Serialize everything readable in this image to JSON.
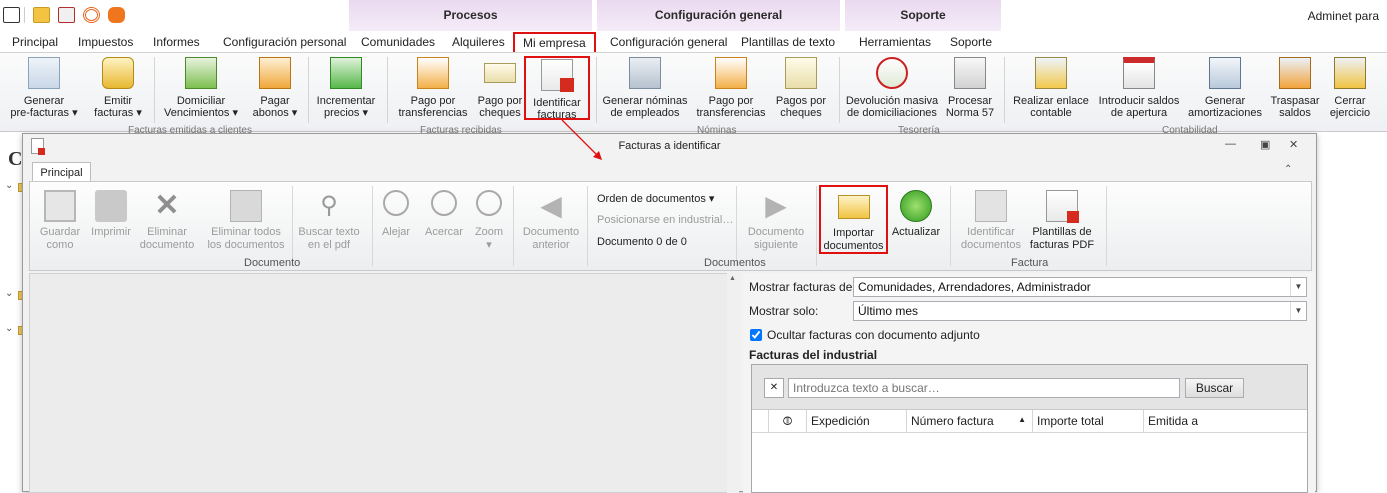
{
  "top": {
    "quick_access": [
      "app-icon",
      "mail-icon",
      "clipboard-icon",
      "rss-icon",
      "owl-icon"
    ],
    "context_groups": [
      "Procesos",
      "Configuración general",
      "Soporte"
    ],
    "app_title": "Adminet para"
  },
  "tabs": [
    "Principal",
    "Impuestos",
    "Informes",
    "Configuración personal",
    "Comunidades",
    "Alquileres",
    "Mi empresa",
    "Configuración general",
    "Plantillas de texto",
    "Herramientas",
    "Soporte"
  ],
  "ribbon": {
    "buttons": [
      {
        "l1": "Generar",
        "l2": "pre-facturas ▾"
      },
      {
        "l1": "Emitir",
        "l2": "facturas ▾"
      },
      {
        "l1": "Domiciliar",
        "l2": "Vencimientos ▾"
      },
      {
        "l1": "Pagar",
        "l2": "abonos ▾"
      },
      {
        "l1": "Incrementar",
        "l2": "precios ▾"
      },
      {
        "l1": "Pago por",
        "l2": "transferencias"
      },
      {
        "l1": "Pago por",
        "l2": "cheques"
      },
      {
        "l1": "Identificar",
        "l2": "facturas"
      },
      {
        "l1": "Generar nóminas",
        "l2": "de empleados"
      },
      {
        "l1": "Pago por",
        "l2": "transferencias"
      },
      {
        "l1": "Pagos por",
        "l2": "cheques"
      },
      {
        "l1": "Devolución masiva",
        "l2": "de domiciliaciones"
      },
      {
        "l1": "Procesar",
        "l2": "Norma 57"
      },
      {
        "l1": "Realizar enlace",
        "l2": "contable"
      },
      {
        "l1": "Introducir saldos",
        "l2": "de apertura"
      },
      {
        "l1": "Generar",
        "l2": "amortizaciones"
      },
      {
        "l1": "Traspasar",
        "l2": "saldos"
      },
      {
        "l1": "Cerrar",
        "l2": "ejercicio"
      }
    ],
    "group_labels": [
      "Facturas emitidas a clientes",
      "Facturas recibidas",
      "Nóminas",
      "Tesorería",
      "Contabilidad"
    ]
  },
  "dialog": {
    "title": "Facturas a identificar",
    "tab": "Principal",
    "buttons": [
      {
        "l1": "Guardar",
        "l2": "como"
      },
      {
        "l1": "Imprimir",
        "l2": ""
      },
      {
        "l1": "Eliminar",
        "l2": "documento"
      },
      {
        "l1": "Eliminar todos",
        "l2": "los documentos"
      },
      {
        "l1": "Buscar texto",
        "l2": "en el pdf"
      },
      {
        "l1": "Alejar",
        "l2": ""
      },
      {
        "l1": "Acercar",
        "l2": ""
      },
      {
        "l1": "Zoom",
        "l2": "▾"
      },
      {
        "l1": "Documento",
        "l2": "anterior"
      },
      {
        "l1": "Documento",
        "l2": "siguiente"
      },
      {
        "l1": "Importar",
        "l2": "documentos"
      },
      {
        "l1": "Actualizar",
        "l2": ""
      },
      {
        "l1": "Identificar",
        "l2": "documentos"
      },
      {
        "l1": "Plantillas de",
        "l2": "facturas PDF"
      }
    ],
    "order_label": "Orden de documentos ▾",
    "position_label": "Posicionarse en industrial…",
    "doc_counter": "Documento 0 de 0",
    "group_labels": [
      "Documento",
      "Documentos",
      "Factura"
    ],
    "show_invoices_label": "Mostrar facturas de:",
    "show_invoices_value": "Comunidades, Arrendadores, Administrador",
    "show_only_label": "Mostrar solo:",
    "show_only_value": "Último mes",
    "hide_checkbox_label": "Ocultar facturas con documento adjunto",
    "hide_checked": true,
    "section_title": "Facturas del industrial",
    "search_placeholder": "Introduzca texto a buscar…",
    "search_button": "Buscar",
    "columns": [
      "Expedición",
      "Número factura",
      "Importe total",
      "Emitida a"
    ]
  }
}
